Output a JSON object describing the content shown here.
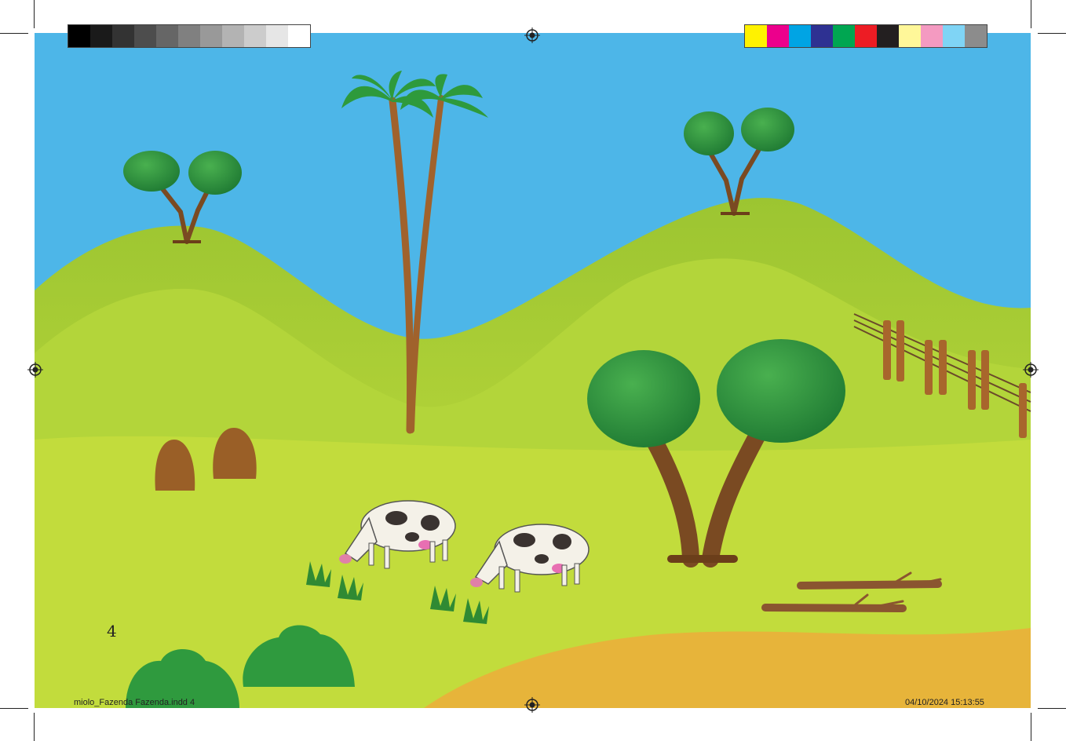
{
  "page_number": "4",
  "slug": {
    "file_name": "miolo_Fazenda Fazenda.indd   4",
    "date_time": "04/10/2024   15:13:55"
  },
  "print_marks": {
    "gray_swatches": [
      "#000000",
      "#1a1a1a",
      "#333333",
      "#4d4d4d",
      "#666666",
      "#808080",
      "#999999",
      "#b3b3b3",
      "#cccccc",
      "#e6e6e6",
      "#ffffff"
    ],
    "color_swatches": [
      "#fff200",
      "#ec008c",
      "#00a4e4",
      "#2e3192",
      "#00a651",
      "#ed1c24",
      "#231f20",
      "#fff799",
      "#f49ac1",
      "#7fd4f5",
      "#8c8c8c"
    ]
  },
  "colors": {
    "sky": "#4db6e8",
    "far_hill": "#a9cf3a",
    "near_hill": "#b8d83a",
    "meadow": "#bcd93b",
    "path": "#e7b43a",
    "foliage": "#2f9a3e",
    "trunk": "#8a5a2b"
  }
}
